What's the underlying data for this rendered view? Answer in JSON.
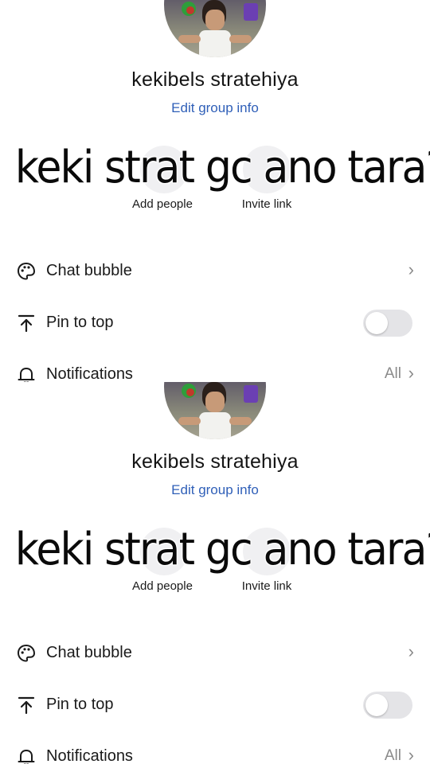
{
  "group": {
    "name": "kekibels stratehiya",
    "edit_label": "Edit group info"
  },
  "caption": "keki strat gc ano tara?",
  "actions": [
    {
      "label": "Add people",
      "icon": "add-person-icon"
    },
    {
      "label": "Invite link",
      "icon": "link-icon"
    }
  ],
  "settings": {
    "chat_bubble": {
      "label": "Chat bubble",
      "icon": "palette-icon"
    },
    "pin_to_top": {
      "label": "Pin to top",
      "icon": "pin-top-icon",
      "enabled": false
    },
    "notifications": {
      "label": "Notifications",
      "icon": "bell-icon",
      "value": "All"
    }
  },
  "colors": {
    "link": "#2f5fb8",
    "secondary_text": "#8a8a8a",
    "toggle_off": "#e4e4e7"
  }
}
